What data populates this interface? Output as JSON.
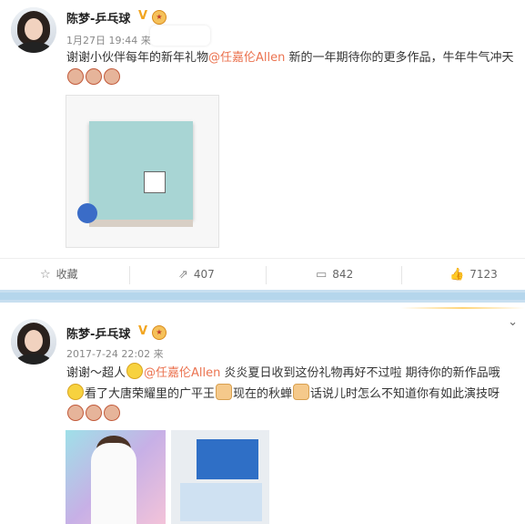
{
  "post1": {
    "author": "陈梦-乒乓球",
    "verified_mark": "V",
    "timestamp": "1月27日 19:44 来",
    "text_intro": "谢谢小伙伴每年的新年礼物",
    "mention": "@任嘉伦Allen",
    "text_rest": " 新的一年期待你的更多作品，牛年牛气冲天",
    "actions": {
      "favorite_label": "收藏",
      "repost_count": "407",
      "comment_count": "842",
      "like_count": "7123"
    }
  },
  "post2": {
    "author": "陈梦-乒乓球",
    "verified_mark": "V",
    "timestamp": "2017-7-24 22:02 来",
    "text_a": "谢谢～超人",
    "mention": "@任嘉伦Allen",
    "text_b": " 炎炎夏日收到这份礼物再好不过啦 期待你的新作品哦",
    "text_c": "看了大唐荣耀里的广平王",
    "text_d": "现在的秋蝉",
    "text_e": "话说儿时怎么不知道你有如此演技呀"
  },
  "colors": {
    "mention": "#eb7350",
    "verified": "#f2a520",
    "divider": "#b5d6ec"
  }
}
